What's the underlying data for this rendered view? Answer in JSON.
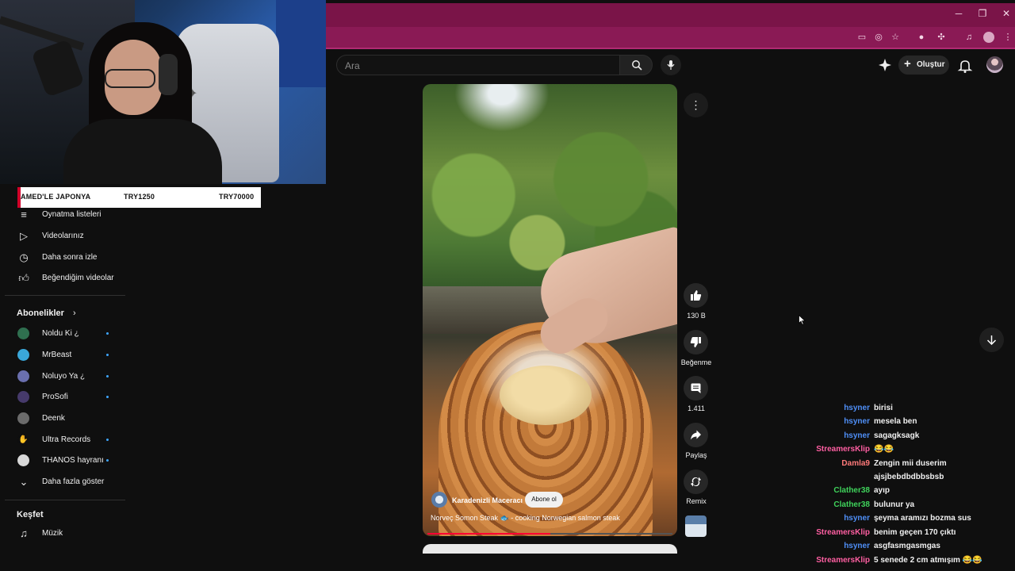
{
  "browser": {
    "minimize": "─",
    "restore": "❐",
    "close": "✕"
  },
  "search": {
    "placeholder": "Ara"
  },
  "header": {
    "create_label": "Oluştur"
  },
  "donation": {
    "text": "AMED'LE JAPONYA",
    "amount": "TRY1250",
    "goal": "TRY70000"
  },
  "nav": {
    "items": [
      {
        "label": "Oynatma listeleri",
        "icon": "playlist-icon"
      },
      {
        "label": "Videolarınız",
        "icon": "your-videos-icon"
      },
      {
        "label": "Daha sonra izle",
        "icon": "watch-later-icon"
      },
      {
        "label": "Beğendiğim videolar",
        "icon": "liked-videos-icon"
      }
    ],
    "subscriptions_title": "Abonelikler",
    "subscriptions": [
      {
        "label": "Noldu Ki ¿",
        "color": "#2f6f4f",
        "dot": true
      },
      {
        "label": "MrBeast",
        "color": "#3aa7d9",
        "dot": true
      },
      {
        "label": "Noluyo Ya ¿",
        "color": "#6a6fae",
        "dot": true
      },
      {
        "label": "ProSofi",
        "color": "#463a6b",
        "dot": true
      },
      {
        "label": "Deenk",
        "color": "#6b6b6b",
        "dot": false
      },
      {
        "label": "Ultra Records",
        "color": "#0f0f0f",
        "dot": true
      },
      {
        "label": "THANOS hayranı",
        "color": "#d8d8d8",
        "dot": true
      }
    ],
    "show_more": "Daha fazla göster",
    "explore_title": "Keşfet",
    "explore": [
      {
        "label": "Müzik",
        "icon": "music-icon"
      }
    ]
  },
  "video": {
    "channel": "Karadenizli Maceracı",
    "subscribe": "Abone ol",
    "title": "Norveç Somon Steak 🐟 - cooking Norwegian salmon steak",
    "progress": 0.5
  },
  "actions": {
    "likes": "130 B",
    "dislike": "Beğenme",
    "comments": "1.411",
    "share": "Paylaş",
    "remix": "Remix"
  },
  "colors": {
    "accent": "#ff0033",
    "chat_blue": "#4f8ff7",
    "chat_pink": "#ff5fa2",
    "chat_green": "#3fd35b",
    "chat_salmon": "#ff7a7a"
  },
  "chat": [
    {
      "name": "hsyner",
      "color": "#4f8ff7",
      "msg": "birisi"
    },
    {
      "name": "hsyner",
      "color": "#4f8ff7",
      "msg": "mesela ben"
    },
    {
      "name": "hsyner",
      "color": "#4f8ff7",
      "msg": "sagagksagk"
    },
    {
      "name": "StreamersKlip",
      "color": "#ff5fa2",
      "msg": "😂😂"
    },
    {
      "name": "Damla9",
      "color": "#ff7a7a",
      "msg": "Zengin mii duserim"
    },
    {
      "name": "",
      "color": "#ff7a7a",
      "msg": "ajsjbebdbdbbsbsb"
    },
    {
      "name": "Clather38",
      "color": "#3fd35b",
      "msg": "ayıp"
    },
    {
      "name": "Clather38",
      "color": "#3fd35b",
      "msg": "bulunur ya"
    },
    {
      "name": "hsyner",
      "color": "#4f8ff7",
      "msg": "şeyma aramızı bozma sus"
    },
    {
      "name": "StreamersKlip",
      "color": "#ff5fa2",
      "msg": "benim geçen 170 çıktı"
    },
    {
      "name": "hsyner",
      "color": "#4f8ff7",
      "msg": "asgfasmgasmgas"
    },
    {
      "name": "StreamersKlip",
      "color": "#ff5fa2",
      "msg": "5 senede 2 cm atmışım 😂😂"
    }
  ]
}
